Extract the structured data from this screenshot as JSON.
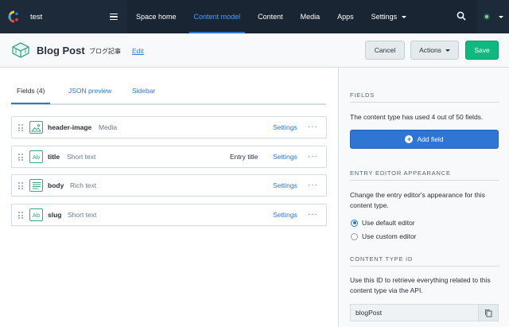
{
  "topnav": {
    "space_name": "test",
    "items": [
      {
        "label": "Space home",
        "active": false
      },
      {
        "label": "Content model",
        "active": true
      },
      {
        "label": "Content",
        "active": false
      },
      {
        "label": "Media",
        "active": false
      },
      {
        "label": "Apps",
        "active": false
      },
      {
        "label": "Settings",
        "active": false
      }
    ]
  },
  "header": {
    "title": "Blog Post",
    "description": "ブログ記事",
    "edit_label": "Edit",
    "cancel_label": "Cancel",
    "actions_label": "Actions",
    "save_label": "Save"
  },
  "tabs": [
    "Fields (4)",
    "JSON preview",
    "Sidebar"
  ],
  "fields": [
    {
      "name": "header-image",
      "type": "Media",
      "tag": "",
      "settings": "Settings",
      "more": "···",
      "icon": "media-icon"
    },
    {
      "name": "title",
      "type": "Short text",
      "tag": "Entry title",
      "settings": "Settings",
      "more": "···",
      "icon": "short-text-icon"
    },
    {
      "name": "body",
      "type": "Rich text",
      "tag": "",
      "settings": "Settings",
      "more": "···",
      "icon": "rich-text-icon"
    },
    {
      "name": "slug",
      "type": "Short text",
      "tag": "",
      "settings": "Settings",
      "more": "···",
      "icon": "short-text-icon"
    }
  ],
  "icon_text": {
    "short_text": "Ab"
  },
  "sidebar": {
    "fields_heading": "Fields",
    "fields_text": "The content type has used 4 out of 50 fields.",
    "add_field_label": "Add field",
    "appearance_heading": "Entry editor appearance",
    "appearance_text": "Change the entry editor's appearance for this content type.",
    "radio_default": "Use default editor",
    "radio_custom": "Use custom editor",
    "id_heading": "Content type ID",
    "id_text": "Use this ID to retrieve everything related to this content type via the API.",
    "id_value": "blogPost"
  },
  "colors": {
    "nav_bg": "#192532",
    "active_blue": "#2e75d4",
    "save_green": "#0eb87f",
    "field_icon_green": "#3aa785"
  }
}
